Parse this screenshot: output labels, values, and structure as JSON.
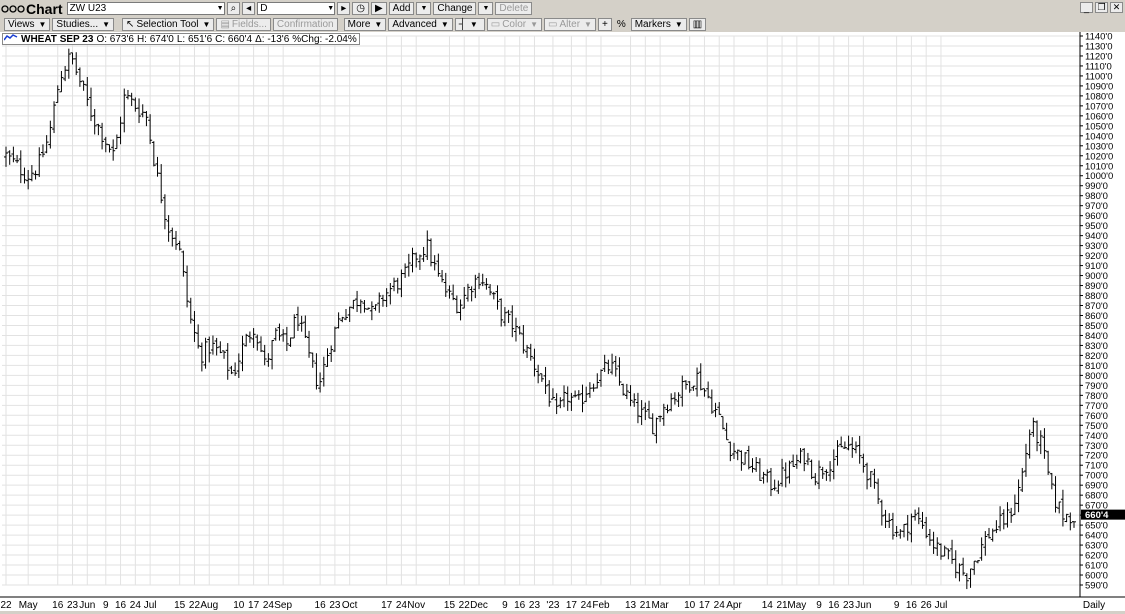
{
  "window": {
    "title": "Chart",
    "symbol": "ZW U23",
    "interval": "D",
    "add_label": "Add",
    "change_label": "Change",
    "delete_label": "Delete"
  },
  "toolbar": {
    "views": "Views",
    "studies": "Studies...",
    "selection_tool": "Selection Tool",
    "fields": "Fields...",
    "confirmation": "Confirmation",
    "more": "More",
    "advanced": "Advanced",
    "color": "Color",
    "alter": "Alter",
    "percent": "%",
    "markers": "Markers"
  },
  "legend": {
    "name": "WHEAT SEP 23",
    "open": "O: 673'6",
    "high": "H: 674'0",
    "low": "L: 651'6",
    "close": "C: 660'4",
    "change": "Δ: -13'6",
    "pct_change": "%Chg: -2.04%"
  },
  "colors": {
    "bars": "#000000",
    "grid": "#e2e2e2",
    "last_price_bg": "#000000"
  },
  "chart_data": {
    "type": "bar",
    "subtype": "ohlc",
    "title": "WHEAT SEP 23",
    "interval_label": "Daily",
    "last_price_label": "660'4",
    "ylim": [
      590,
      1140
    ],
    "y_ticks": [
      "1140'0",
      "1130'0",
      "1120'0",
      "1110'0",
      "1100'0",
      "1090'0",
      "1080'0",
      "1070'0",
      "1060'0",
      "1050'0",
      "1040'0",
      "1030'0",
      "1020'0",
      "1010'0",
      "1000'0",
      "990'0",
      "980'0",
      "970'0",
      "960'0",
      "950'0",
      "940'0",
      "930'0",
      "920'0",
      "910'0",
      "900'0",
      "890'0",
      "880'0",
      "870'0",
      "860'0",
      "850'0",
      "840'0",
      "830'0",
      "820'0",
      "810'0",
      "800'0",
      "790'0",
      "780'0",
      "770'0",
      "760'0",
      "750'0",
      "740'0",
      "730'0",
      "720'0",
      "710'0",
      "700'0",
      "690'0",
      "680'0",
      "670'0",
      "660'0",
      "650'0",
      "640'0",
      "630'0",
      "620'0",
      "610'0",
      "600'0",
      "590'0"
    ],
    "x_ticks": [
      "22",
      "May",
      "16",
      "23",
      "Jun",
      "9",
      "16",
      "24",
      "Jul",
      "15",
      "22",
      "Aug",
      "10",
      "17",
      "24",
      "Sep",
      "16",
      "23",
      "Oct",
      "17",
      "24",
      "Nov",
      "15",
      "22",
      "Dec",
      "9",
      "16",
      "23",
      "'23",
      "17",
      "24",
      "Feb",
      "13",
      "21",
      "Mar",
      "10",
      "17",
      "24",
      "Apr",
      "14",
      "21",
      "May",
      "9",
      "16",
      "23",
      "Jun",
      "9",
      "16",
      "26",
      "Jul"
    ],
    "x_tick_index": [
      0,
      6,
      14,
      18,
      22,
      27,
      31,
      35,
      39,
      47,
      51,
      55,
      63,
      67,
      71,
      75,
      85,
      89,
      93,
      103,
      107,
      111,
      120,
      124,
      128,
      135,
      139,
      143,
      148,
      153,
      157,
      161,
      169,
      173,
      177,
      185,
      189,
      193,
      197,
      206,
      210,
      214,
      220,
      224,
      228,
      232,
      241,
      245,
      249,
      253
    ],
    "close_path": [
      1020,
      1010,
      1000,
      1010,
      1040,
      1100,
      1120,
      1090,
      1060,
      1040,
      1020,
      1080,
      1070,
      1060,
      1000,
      950,
      930,
      860,
      820,
      830,
      820,
      800,
      830,
      850,
      810,
      840,
      830,
      860,
      820,
      790,
      830,
      860,
      870,
      880,
      860,
      880,
      890,
      900,
      920,
      930,
      900,
      880,
      870,
      890,
      900,
      880,
      860,
      850,
      830,
      810,
      790,
      760,
      780,
      770,
      790,
      800,
      810,
      790,
      770,
      760,
      750,
      770,
      780,
      790,
      800,
      780,
      760,
      730,
      720,
      710,
      700,
      690,
      700,
      710,
      720,
      700,
      710,
      720,
      730,
      720,
      700,
      670,
      650,
      640,
      660,
      650,
      630,
      620,
      610,
      600,
      620,
      640,
      650,
      660,
      690,
      750,
      730,
      680,
      660,
      660
    ],
    "n_bars": 290
  }
}
